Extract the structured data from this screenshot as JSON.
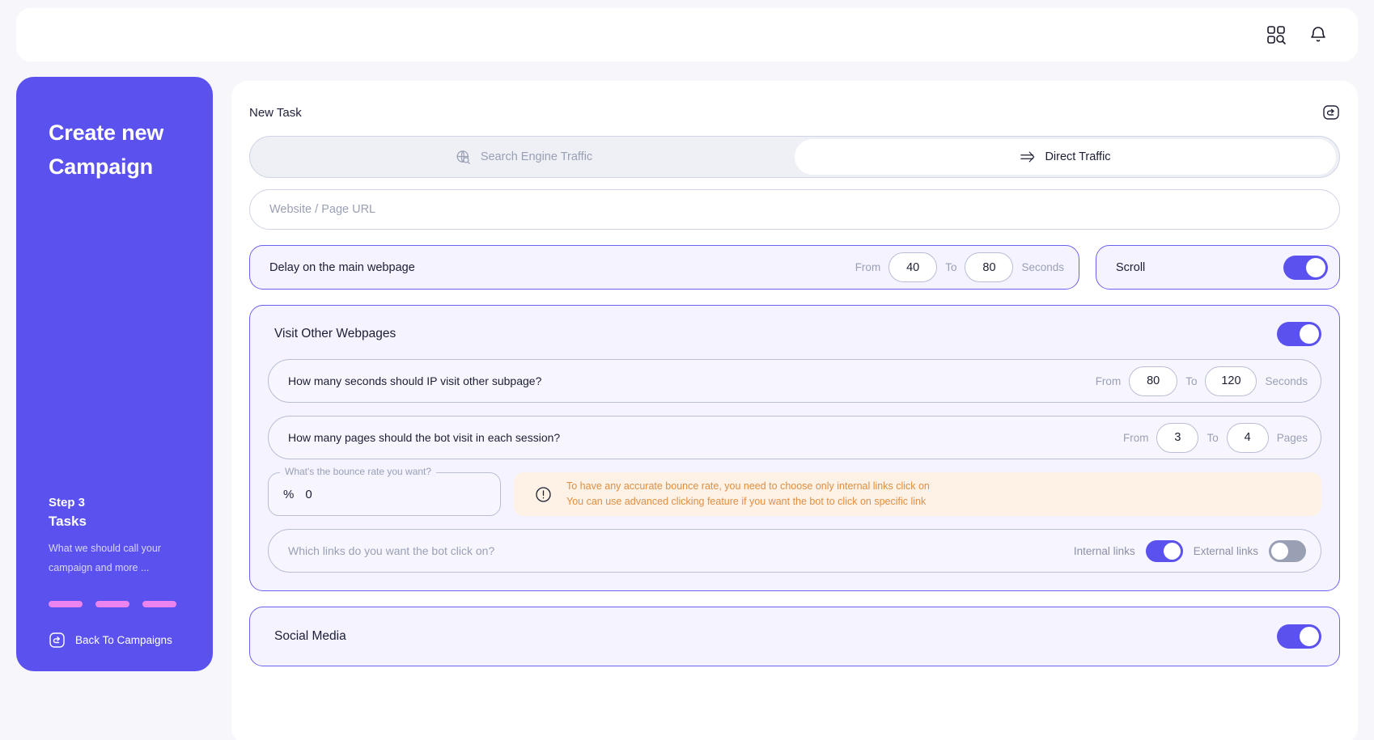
{
  "topbar": {
    "scan_icon": "qr-scan-icon",
    "bell_icon": "bell-icon"
  },
  "sidebar": {
    "title_line1": "Create new",
    "title_line2": "Campaign",
    "step_label": "Step 3",
    "step_name": "Tasks",
    "step_desc": "What we should call your campaign and more ...",
    "dots_count": 3,
    "back_label": "Back To Campaigns",
    "back_icon": "back-arrow-box-icon",
    "bg_color": "#5a51ee",
    "dot_color": "#ec84ef"
  },
  "main": {
    "title": "New Task",
    "collapse_icon": "collapse-panel-icon",
    "tabs": [
      {
        "label": "Search Engine Traffic",
        "icon": "globe-search-icon",
        "active": false
      },
      {
        "label": "Direct Traffic",
        "icon": "double-arrow-right-icon",
        "active": true
      }
    ],
    "url_input": {
      "placeholder": "Website / Page URL",
      "value": ""
    },
    "delay": {
      "label": "Delay on the main webpage",
      "from_label": "From",
      "from_value": "40",
      "to_label": "To",
      "to_value": "80",
      "unit": "Seconds"
    },
    "scroll": {
      "label": "Scroll",
      "enabled": true
    },
    "visit_other": {
      "title": "Visit Other Webpages",
      "enabled": true,
      "seconds_row": {
        "label": "How many seconds should IP visit other subpage?",
        "from_label": "From",
        "from_value": "80",
        "to_label": "To",
        "to_value": "120",
        "unit": "Seconds"
      },
      "pages_row": {
        "label": "How many pages should the bot visit in each session?",
        "from_label": "From",
        "from_value": "3",
        "to_label": "To",
        "to_value": "4",
        "unit": "Pages"
      },
      "bounce": {
        "legend": "What's the bounce rate you want?",
        "percent_sign": "%",
        "value": "0"
      },
      "warning": {
        "icon": "alert-circle-icon",
        "line1": "To have any accurate bounce rate, you need to choose only internal links click on",
        "line2": "You can use advanced clicking feature if you want the bot to click on specific link",
        "text_color": "#e08e43",
        "bg_color": "#fdf2e5"
      },
      "links": {
        "placeholder": "Which links do you want the bot click on?",
        "internal_label": "Internal links",
        "internal_enabled": true,
        "external_label": "External links",
        "external_enabled": false
      }
    },
    "social_media": {
      "title": "Social Media",
      "enabled": true
    }
  },
  "theme": {
    "accent": "#5a51ee",
    "panel_bg": "#f4f3ff",
    "page_bg": "#f7f7fb"
  }
}
